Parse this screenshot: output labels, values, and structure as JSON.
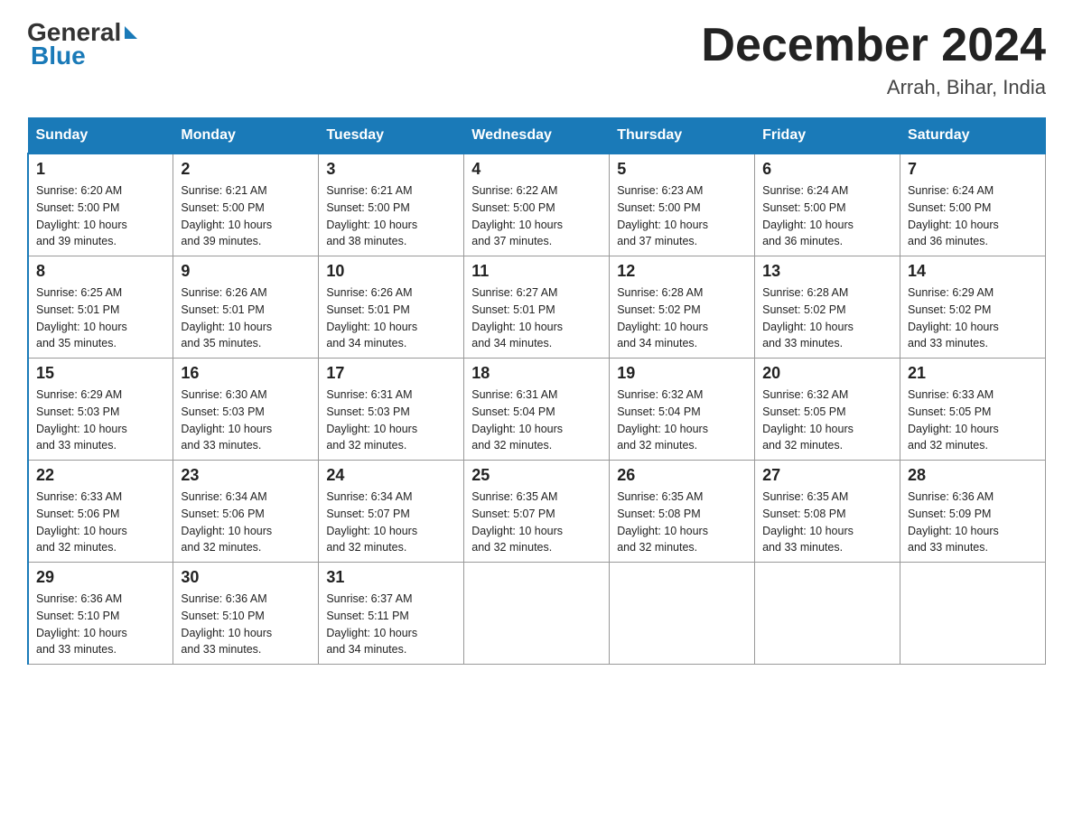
{
  "logo": {
    "general": "General",
    "blue": "Blue"
  },
  "title": "December 2024",
  "location": "Arrah, Bihar, India",
  "days_of_week": [
    "Sunday",
    "Monday",
    "Tuesday",
    "Wednesday",
    "Thursday",
    "Friday",
    "Saturday"
  ],
  "weeks": [
    [
      {
        "day": "1",
        "sunrise": "6:20 AM",
        "sunset": "5:00 PM",
        "daylight": "10 hours and 39 minutes."
      },
      {
        "day": "2",
        "sunrise": "6:21 AM",
        "sunset": "5:00 PM",
        "daylight": "10 hours and 39 minutes."
      },
      {
        "day": "3",
        "sunrise": "6:21 AM",
        "sunset": "5:00 PM",
        "daylight": "10 hours and 38 minutes."
      },
      {
        "day": "4",
        "sunrise": "6:22 AM",
        "sunset": "5:00 PM",
        "daylight": "10 hours and 37 minutes."
      },
      {
        "day": "5",
        "sunrise": "6:23 AM",
        "sunset": "5:00 PM",
        "daylight": "10 hours and 37 minutes."
      },
      {
        "day": "6",
        "sunrise": "6:24 AM",
        "sunset": "5:00 PM",
        "daylight": "10 hours and 36 minutes."
      },
      {
        "day": "7",
        "sunrise": "6:24 AM",
        "sunset": "5:00 PM",
        "daylight": "10 hours and 36 minutes."
      }
    ],
    [
      {
        "day": "8",
        "sunrise": "6:25 AM",
        "sunset": "5:01 PM",
        "daylight": "10 hours and 35 minutes."
      },
      {
        "day": "9",
        "sunrise": "6:26 AM",
        "sunset": "5:01 PM",
        "daylight": "10 hours and 35 minutes."
      },
      {
        "day": "10",
        "sunrise": "6:26 AM",
        "sunset": "5:01 PM",
        "daylight": "10 hours and 34 minutes."
      },
      {
        "day": "11",
        "sunrise": "6:27 AM",
        "sunset": "5:01 PM",
        "daylight": "10 hours and 34 minutes."
      },
      {
        "day": "12",
        "sunrise": "6:28 AM",
        "sunset": "5:02 PM",
        "daylight": "10 hours and 34 minutes."
      },
      {
        "day": "13",
        "sunrise": "6:28 AM",
        "sunset": "5:02 PM",
        "daylight": "10 hours and 33 minutes."
      },
      {
        "day": "14",
        "sunrise": "6:29 AM",
        "sunset": "5:02 PM",
        "daylight": "10 hours and 33 minutes."
      }
    ],
    [
      {
        "day": "15",
        "sunrise": "6:29 AM",
        "sunset": "5:03 PM",
        "daylight": "10 hours and 33 minutes."
      },
      {
        "day": "16",
        "sunrise": "6:30 AM",
        "sunset": "5:03 PM",
        "daylight": "10 hours and 33 minutes."
      },
      {
        "day": "17",
        "sunrise": "6:31 AM",
        "sunset": "5:03 PM",
        "daylight": "10 hours and 32 minutes."
      },
      {
        "day": "18",
        "sunrise": "6:31 AM",
        "sunset": "5:04 PM",
        "daylight": "10 hours and 32 minutes."
      },
      {
        "day": "19",
        "sunrise": "6:32 AM",
        "sunset": "5:04 PM",
        "daylight": "10 hours and 32 minutes."
      },
      {
        "day": "20",
        "sunrise": "6:32 AM",
        "sunset": "5:05 PM",
        "daylight": "10 hours and 32 minutes."
      },
      {
        "day": "21",
        "sunrise": "6:33 AM",
        "sunset": "5:05 PM",
        "daylight": "10 hours and 32 minutes."
      }
    ],
    [
      {
        "day": "22",
        "sunrise": "6:33 AM",
        "sunset": "5:06 PM",
        "daylight": "10 hours and 32 minutes."
      },
      {
        "day": "23",
        "sunrise": "6:34 AM",
        "sunset": "5:06 PM",
        "daylight": "10 hours and 32 minutes."
      },
      {
        "day": "24",
        "sunrise": "6:34 AM",
        "sunset": "5:07 PM",
        "daylight": "10 hours and 32 minutes."
      },
      {
        "day": "25",
        "sunrise": "6:35 AM",
        "sunset": "5:07 PM",
        "daylight": "10 hours and 32 minutes."
      },
      {
        "day": "26",
        "sunrise": "6:35 AM",
        "sunset": "5:08 PM",
        "daylight": "10 hours and 32 minutes."
      },
      {
        "day": "27",
        "sunrise": "6:35 AM",
        "sunset": "5:08 PM",
        "daylight": "10 hours and 33 minutes."
      },
      {
        "day": "28",
        "sunrise": "6:36 AM",
        "sunset": "5:09 PM",
        "daylight": "10 hours and 33 minutes."
      }
    ],
    [
      {
        "day": "29",
        "sunrise": "6:36 AM",
        "sunset": "5:10 PM",
        "daylight": "10 hours and 33 minutes."
      },
      {
        "day": "30",
        "sunrise": "6:36 AM",
        "sunset": "5:10 PM",
        "daylight": "10 hours and 33 minutes."
      },
      {
        "day": "31",
        "sunrise": "6:37 AM",
        "sunset": "5:11 PM",
        "daylight": "10 hours and 34 minutes."
      },
      null,
      null,
      null,
      null
    ]
  ],
  "labels": {
    "sunrise": "Sunrise:",
    "sunset": "Sunset:",
    "daylight": "Daylight:"
  }
}
